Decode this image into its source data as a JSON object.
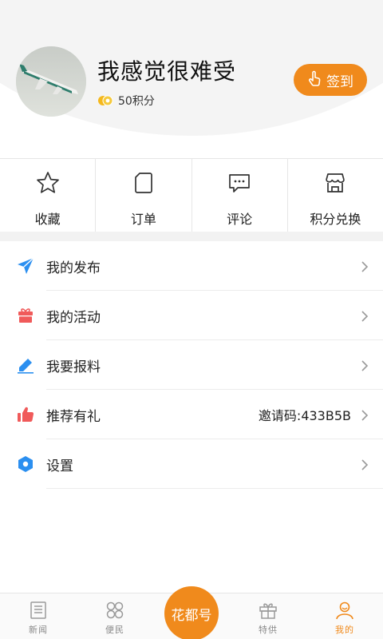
{
  "profile": {
    "username": "我感觉很难受",
    "points_text": "50积分",
    "signin_label": "签到",
    "avatar_icon": "airplane-photo"
  },
  "quick_actions": [
    {
      "label": "收藏",
      "icon": "star-icon"
    },
    {
      "label": "订单",
      "icon": "document-icon"
    },
    {
      "label": "评论",
      "icon": "chat-icon"
    },
    {
      "label": "积分兑换",
      "icon": "store-icon"
    }
  ],
  "menu": [
    {
      "label": "我的发布",
      "icon": "send-icon",
      "extra": ""
    },
    {
      "label": "我的活动",
      "icon": "gift-icon",
      "extra": ""
    },
    {
      "label": "我要报料",
      "icon": "pen-icon",
      "extra": ""
    },
    {
      "label": "推荐有礼",
      "icon": "thumbs-up-icon",
      "extra": "邀请码:433B5B"
    },
    {
      "label": "设置",
      "icon": "settings-icon",
      "extra": ""
    }
  ],
  "bottom_nav": {
    "tabs": [
      {
        "label": "新闻",
        "icon": "news-icon"
      },
      {
        "label": "便民",
        "icon": "grid-icon"
      },
      {
        "label": "特供",
        "icon": "gift-box-icon"
      },
      {
        "label": "我的",
        "icon": "person-icon"
      }
    ],
    "center_label": "花都号",
    "active_tab": "我的"
  },
  "colors": {
    "accent": "#f08a1c",
    "send": "#2b8ff0",
    "gift": "#f05a5a",
    "pen": "#2b8ff0",
    "thumb": "#f05a5a",
    "settings": "#2b8ff0"
  }
}
